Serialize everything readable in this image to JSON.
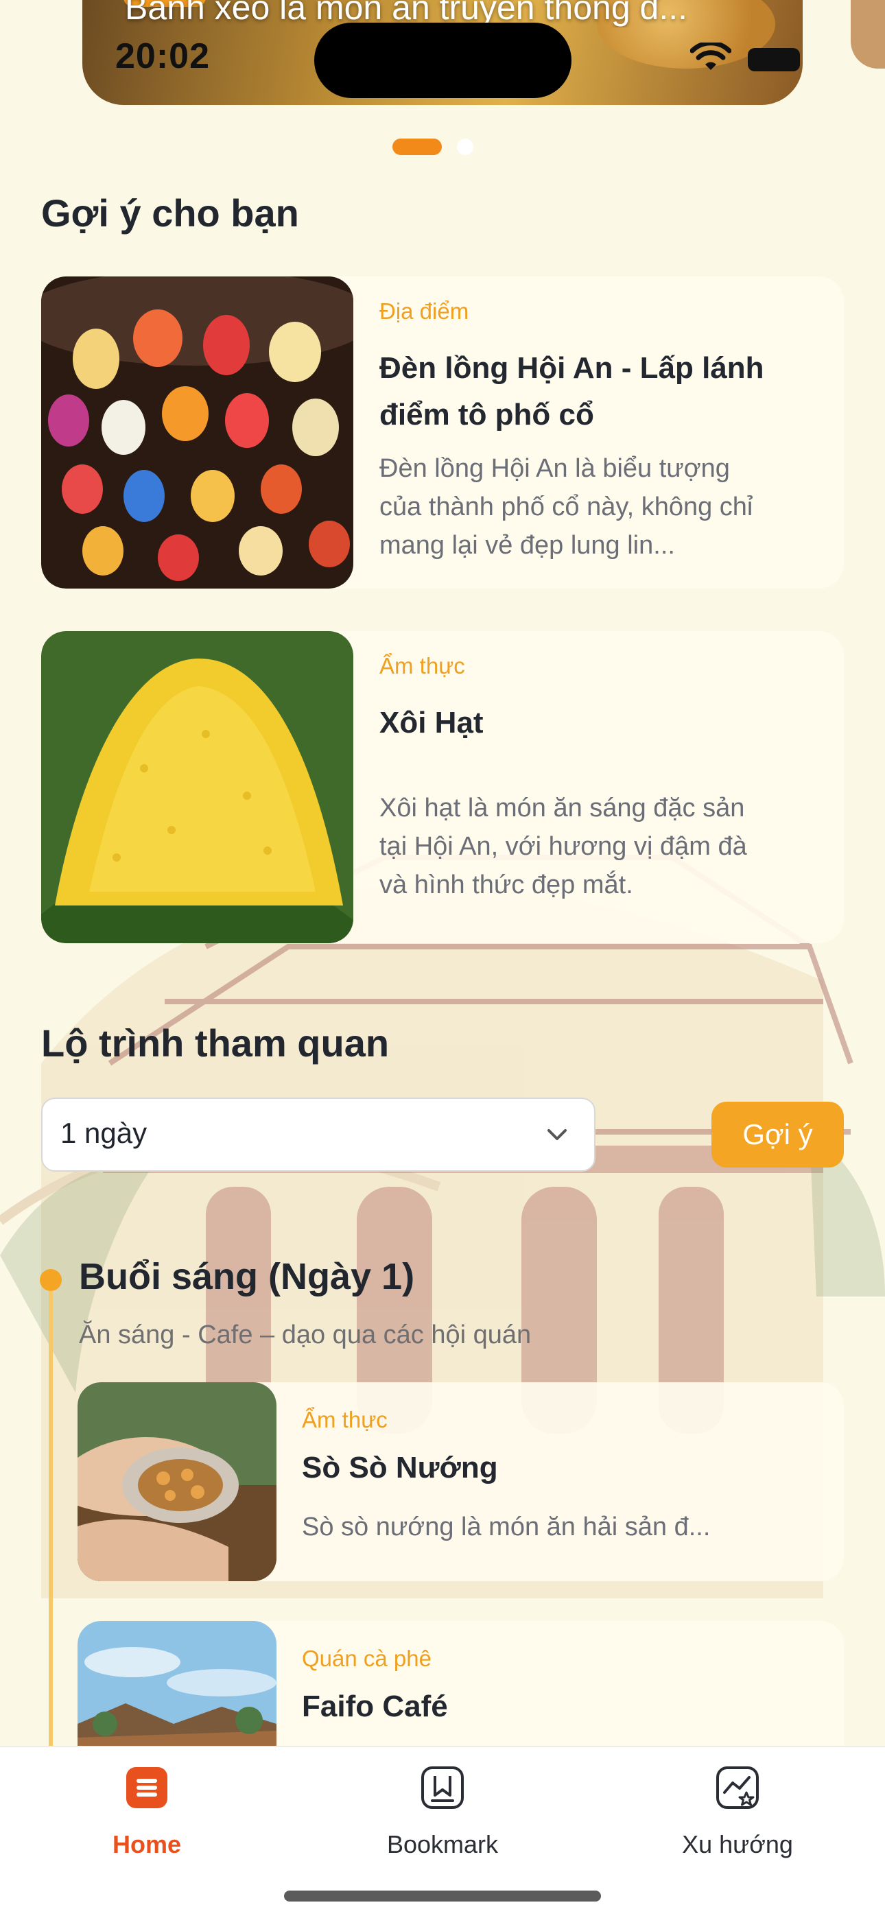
{
  "status": {
    "time": "20:02"
  },
  "hero": {
    "caption": "Bánh xèo là món ăn truyền thống đ..."
  },
  "carousel": {
    "active_index": 0,
    "count": 2
  },
  "suggestions": {
    "title": "Gợi ý cho bạn",
    "items": [
      {
        "category": "Địa điểm",
        "title": "Đèn lồng Hội An - Lấp lánh điểm tô phố cổ",
        "description": "Đèn lồng Hội An là biểu tượng của thành phố cổ này, không chỉ mang lại vẻ đẹp lung lin..."
      },
      {
        "category": "Ẩm thực",
        "title": "Xôi Hạt",
        "description": "Xôi hạt là món ăn sáng đặc sản tại Hội An, với hương vị đậm đà và hình thức đẹp mắt."
      }
    ]
  },
  "route": {
    "title": "Lộ trình tham quan",
    "duration_value": "1 ngày",
    "suggest_button": "Gợi ý",
    "session": {
      "title": "Buổi sáng (Ngày 1)",
      "subtitle": "Ăn sáng - Cafe – dạo qua các hội quán",
      "items": [
        {
          "category": "Ẩm thực",
          "title": "Sò Sò Nướng",
          "description": "Sò sò nướng là món ăn hải sản đ..."
        },
        {
          "category": "Quán cà phê",
          "title": "Faifo Café",
          "description": ""
        }
      ]
    }
  },
  "nav": {
    "items": [
      {
        "label": "Home",
        "icon": "home-icon",
        "active": true
      },
      {
        "label": "Bookmark",
        "icon": "bookmark-icon",
        "active": false
      },
      {
        "label": "Xu hướng",
        "icon": "trend-icon",
        "active": false
      }
    ]
  },
  "colors": {
    "accent": "#f5a524",
    "active_nav": "#e8501e",
    "category_text": "#f0a020",
    "background": "#fcf8e6"
  }
}
